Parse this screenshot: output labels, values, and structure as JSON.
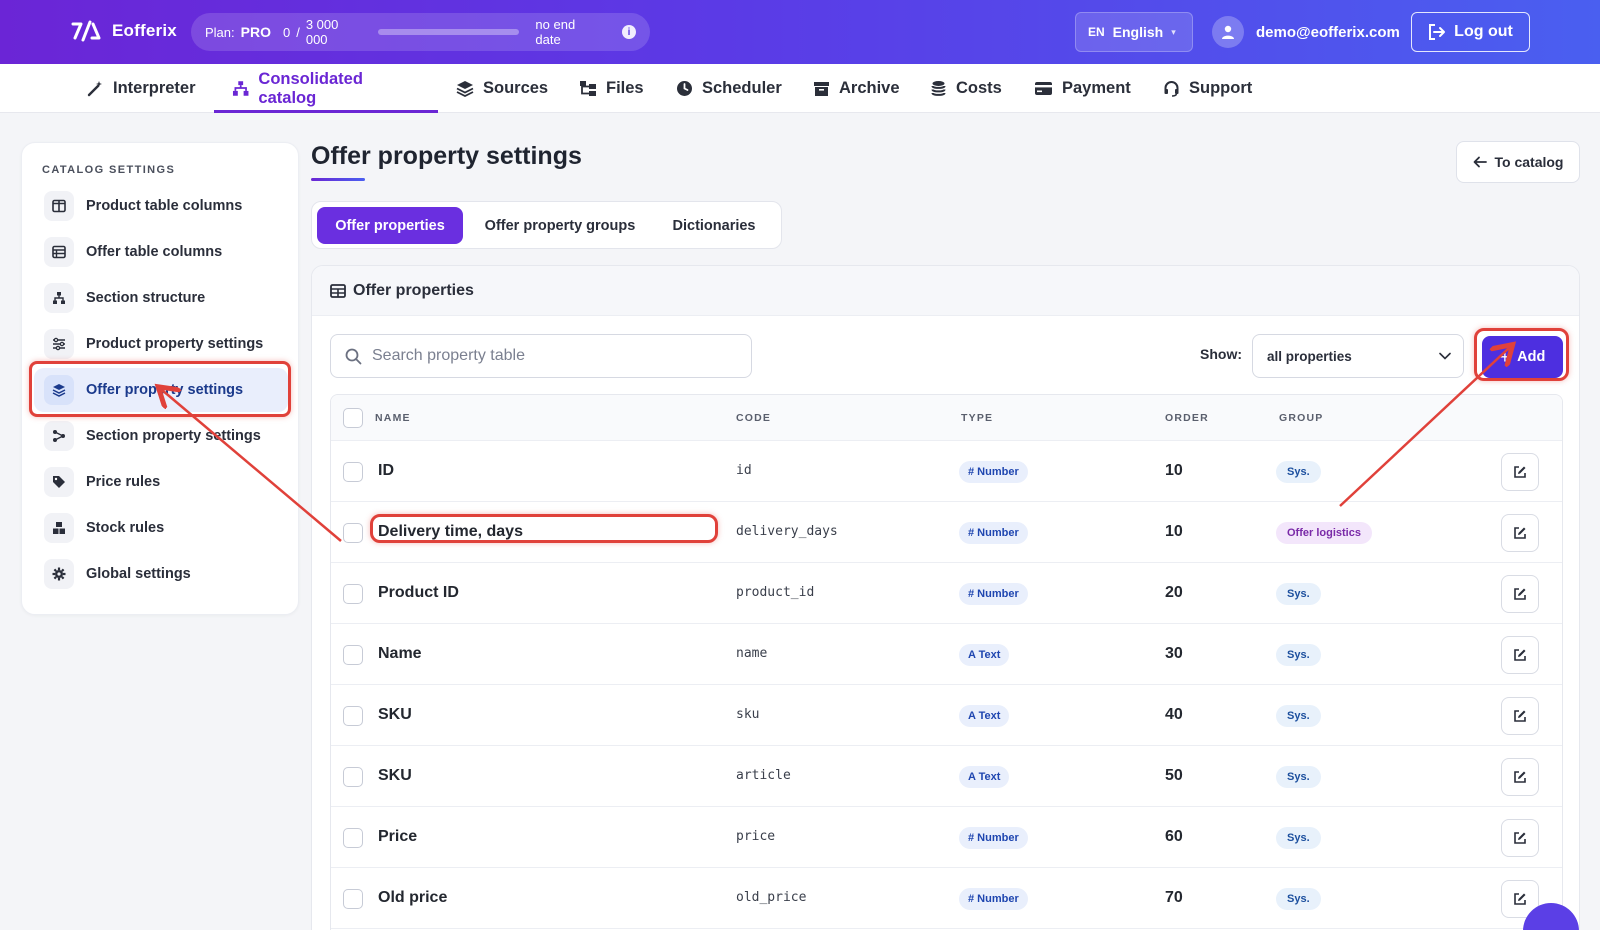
{
  "app": {
    "name": "Eofferix"
  },
  "plan": {
    "label": "Plan:",
    "name": "PRO",
    "usage": "0",
    "separator": "/",
    "limit": "3 000 000",
    "usage_fraction": 0.0,
    "expiry": "no end date",
    "info_icon": "info-icon"
  },
  "language": {
    "code": "EN",
    "name": "English"
  },
  "user": {
    "email": "demo@eofferix.com"
  },
  "logout": {
    "label": "Log out"
  },
  "nav": [
    {
      "label": "Interpreter",
      "icon": "magic-wand-icon"
    },
    {
      "label": "Consolidated catalog",
      "icon": "sitemap-icon",
      "active": true
    },
    {
      "label": "Sources",
      "icon": "layers-icon"
    },
    {
      "label": "Files",
      "icon": "folder-tree-icon"
    },
    {
      "label": "Scheduler",
      "icon": "clock-icon"
    },
    {
      "label": "Archive",
      "icon": "archive-icon"
    },
    {
      "label": "Costs",
      "icon": "coins-icon"
    },
    {
      "label": "Payment",
      "icon": "credit-card-icon"
    },
    {
      "label": "Support",
      "icon": "headset-icon"
    }
  ],
  "sidebar": {
    "title": "CATALOG SETTINGS",
    "items": [
      {
        "label": "Product table columns",
        "icon": "columns-icon"
      },
      {
        "label": "Offer table columns",
        "icon": "table-icon"
      },
      {
        "label": "Section structure",
        "icon": "sitemap-icon"
      },
      {
        "label": "Product property settings",
        "icon": "sliders-icon"
      },
      {
        "label": "Offer property settings",
        "icon": "layers-icon",
        "active": true
      },
      {
        "label": "Section property settings",
        "icon": "share-nodes-icon"
      },
      {
        "label": "Price rules",
        "icon": "tags-icon"
      },
      {
        "label": "Stock rules",
        "icon": "boxes-icon"
      },
      {
        "label": "Global settings",
        "icon": "gear-icon"
      }
    ]
  },
  "page": {
    "title": "Offer property settings",
    "back_label": "To catalog"
  },
  "tabs": [
    {
      "label": "Offer properties",
      "active": true
    },
    {
      "label": "Offer property groups"
    },
    {
      "label": "Dictionaries"
    }
  ],
  "card": {
    "title": "Offer properties"
  },
  "search": {
    "placeholder": "Search property table"
  },
  "filter": {
    "label": "Show:",
    "value": "all properties"
  },
  "add_button": {
    "label": "Add"
  },
  "table": {
    "columns": [
      "NAME",
      "CODE",
      "TYPE",
      "ORDER",
      "GROUP"
    ],
    "rows": [
      {
        "name": "ID",
        "code": "id",
        "type": "# Number",
        "order": "10",
        "group": "Sys."
      },
      {
        "name": "Delivery time, days",
        "code": "delivery_days",
        "type": "# Number",
        "order": "10",
        "group": "Offer logistics"
      },
      {
        "name": "Product ID",
        "code": "product_id",
        "type": "# Number",
        "order": "20",
        "group": "Sys."
      },
      {
        "name": "Name",
        "code": "name",
        "type": "A Text",
        "order": "30",
        "group": "Sys."
      },
      {
        "name": "SKU",
        "code": "sku",
        "type": "A Text",
        "order": "40",
        "group": "Sys."
      },
      {
        "name": "SKU",
        "code": "article",
        "type": "A Text",
        "order": "50",
        "group": "Sys."
      },
      {
        "name": "Price",
        "code": "price",
        "type": "# Number",
        "order": "60",
        "group": "Sys."
      },
      {
        "name": "Old price",
        "code": "old_price",
        "type": "# Number",
        "order": "70",
        "group": "Sys."
      }
    ]
  },
  "colors": {
    "brand": "#6a26d4",
    "accent": "#4d2fe0",
    "highlight": "#e0413a"
  }
}
